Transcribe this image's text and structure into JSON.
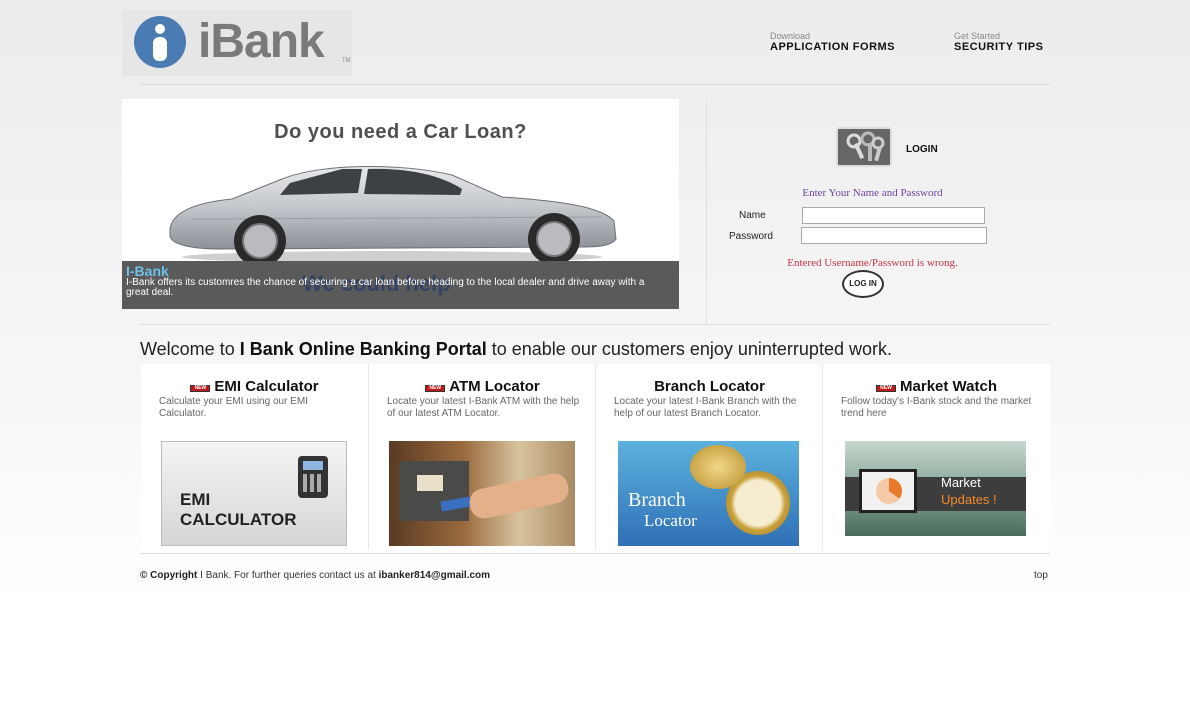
{
  "header": {
    "logo_text": "iBank",
    "logo_tm": "TM",
    "links": [
      {
        "small": "Download",
        "big": "APPLICATION FORMS"
      },
      {
        "small": "Get Started",
        "big": "SECURITY TIPS"
      }
    ]
  },
  "banner": {
    "title": "Do you need a Car Loan?",
    "caption_title": "I-Bank",
    "caption_ghost": "We could help",
    "caption_text": "I-Bank offers its customres the chance of securing a car loan before heading to the local dealer and drive away with a great deal."
  },
  "login": {
    "label": "LOGIN",
    "hint": "Enter Your Name and Password",
    "name_label": "Name",
    "password_label": "Password",
    "name_value": "",
    "password_value": "",
    "error": "Entered Username/Password is wrong.",
    "button": "LOG IN"
  },
  "welcome": {
    "prefix": "Welcome to ",
    "bold": "I Bank Online Banking Portal",
    "suffix": " to enable our customers enjoy uninterrupted work."
  },
  "cards": [
    {
      "title": "EMI Calculator",
      "new": true,
      "desc": "Calculate your EMI using our EMI Calculator.",
      "img_line1": "EMI",
      "img_line2": "CALCULATOR"
    },
    {
      "title": "ATM Locator",
      "new": true,
      "desc": "Locate your latest I-Bank ATM with the help of our latest ATM Locator."
    },
    {
      "title": "Branch Locator",
      "new": false,
      "desc": "Locate your latest I-Bank Branch with the help of our latest Branch Locator.",
      "img_line1": "Branch",
      "img_line2": "Locator"
    },
    {
      "title": "Market Watch",
      "new": true,
      "desc": "Follow today's I-Bank stock and the market trend here",
      "img_line1": "Market",
      "img_line2": "Updates !"
    }
  ],
  "new_badge": "NEW",
  "footer": {
    "copyright_bold": "© Copyright",
    "text": " I Bank. For further queries contact us at ",
    "email": "ibanker814@gmail.com",
    "top": "top"
  }
}
